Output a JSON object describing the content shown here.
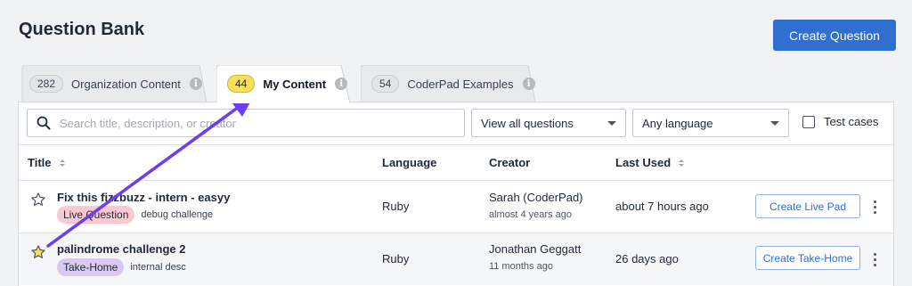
{
  "page": {
    "title": "Question Bank",
    "create_button": "Create Question"
  },
  "tabs": [
    {
      "count": "282",
      "label": "Organization Content",
      "active": false
    },
    {
      "count": "44",
      "label": "My Content",
      "active": true
    },
    {
      "count": "54",
      "label": "CoderPad Examples",
      "active": false
    }
  ],
  "filters": {
    "search_placeholder": "Search title, description, or creator",
    "view_select": "View all questions",
    "language_select": "Any language",
    "test_cases_label": "Test cases"
  },
  "table": {
    "headers": {
      "title": "Title",
      "language": "Language",
      "creator": "Creator",
      "last_used": "Last Used"
    },
    "rows": [
      {
        "title": "Fix this fizzbuzz - intern - easyy",
        "tag": "Live Question",
        "description": "debug challenge",
        "language": "Ruby",
        "creator": "Sarah (CoderPad)",
        "created": "almost 4 years ago",
        "last_used": "about 7 hours ago",
        "action": "Create Live Pad",
        "starred": false
      },
      {
        "title": "palindrome challenge 2",
        "tag": "Take-Home",
        "description": "internal desc",
        "language": "Ruby",
        "creator": "Jonathan Geggatt",
        "created": "11 months ago",
        "last_used": "26 days ago",
        "action": "Create Take-Home",
        "starred": true
      }
    ]
  },
  "colors": {
    "accent": "#2f6fd0",
    "annotation_arrow": "#6b3ff0",
    "active_badge": "#f6e05e"
  },
  "info_icon_glyph": "i"
}
